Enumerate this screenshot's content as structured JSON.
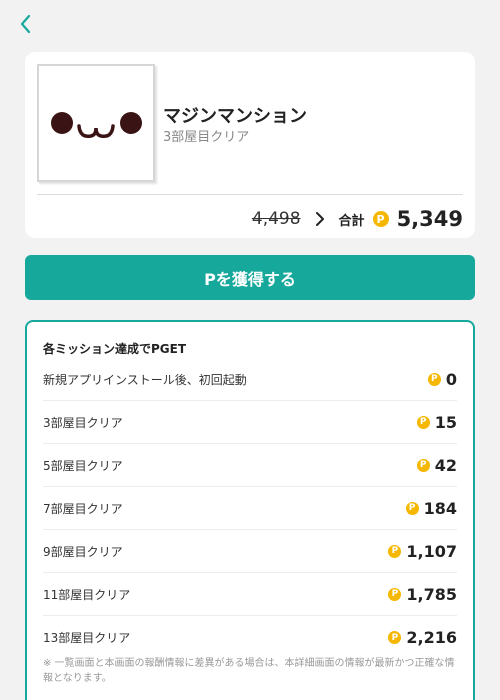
{
  "nav": {
    "back_icon": "chevron-left-icon"
  },
  "app": {
    "name": "マジンマンション",
    "progress": "3部屋目クリア",
    "icon": "kaomoji-face-icon"
  },
  "points": {
    "old": "4,498",
    "total_label": "合計",
    "total": "5,349",
    "coin_symbol": "P"
  },
  "cta": {
    "label": "Pを獲得する"
  },
  "missions": {
    "title": "各ミッション達成でPGET",
    "items": [
      {
        "label": "新規アプリインストール後、初回起動",
        "points": "0"
      },
      {
        "label": "3部屋目クリア",
        "points": "15"
      },
      {
        "label": "5部屋目クリア",
        "points": "42"
      },
      {
        "label": "7部屋目クリア",
        "points": "184"
      },
      {
        "label": "9部屋目クリア",
        "points": "1,107"
      },
      {
        "label": "11部屋目クリア",
        "points": "1,785"
      },
      {
        "label": "13部屋目クリア",
        "points": "2,216"
      }
    ],
    "note": "※ 一覧画面と本画面の報酬情報に差異がある場合は、本詳細画面の情報が最新かつ正確な情報となります。"
  },
  "colors": {
    "accent": "#17a89c",
    "coin": "#f5b700",
    "background": "#f2f2f2"
  }
}
